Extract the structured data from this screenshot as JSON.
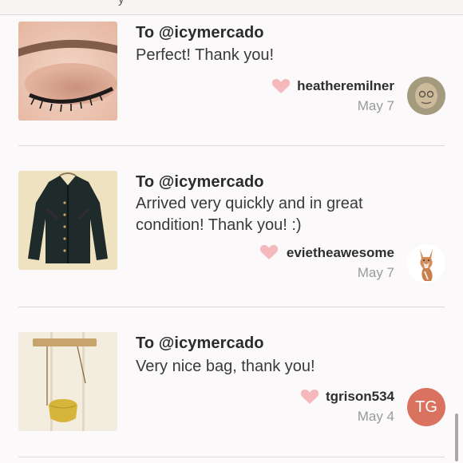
{
  "topbar": {
    "peek_text": "y"
  },
  "reviews": [
    {
      "recipient": "To @icymercado",
      "message": "Perfect! Thank you!",
      "username": "heatheremilner",
      "date": "May 7",
      "thumb_subject": "eyeshadow swatch photo",
      "avatar_type": "photo"
    },
    {
      "recipient": "To @icymercado",
      "message": "Arrived very quickly and in great condition! Thank you! :)",
      "username": "evietheawesome",
      "date": "May 7",
      "thumb_subject": "dark cardigan photo",
      "avatar_type": "fox illustration"
    },
    {
      "recipient": "To @icymercado",
      "message": "Very nice bag, thank you!",
      "username": "tgrison534",
      "date": "May 4",
      "thumb_subject": "yellow bag photo",
      "avatar_initials": "TG",
      "avatar_color": "#d9735f"
    }
  ],
  "colors": {
    "heart": "#f4b8bd",
    "accent_avatar": "#d9735f",
    "date": "#9a9a9a"
  }
}
